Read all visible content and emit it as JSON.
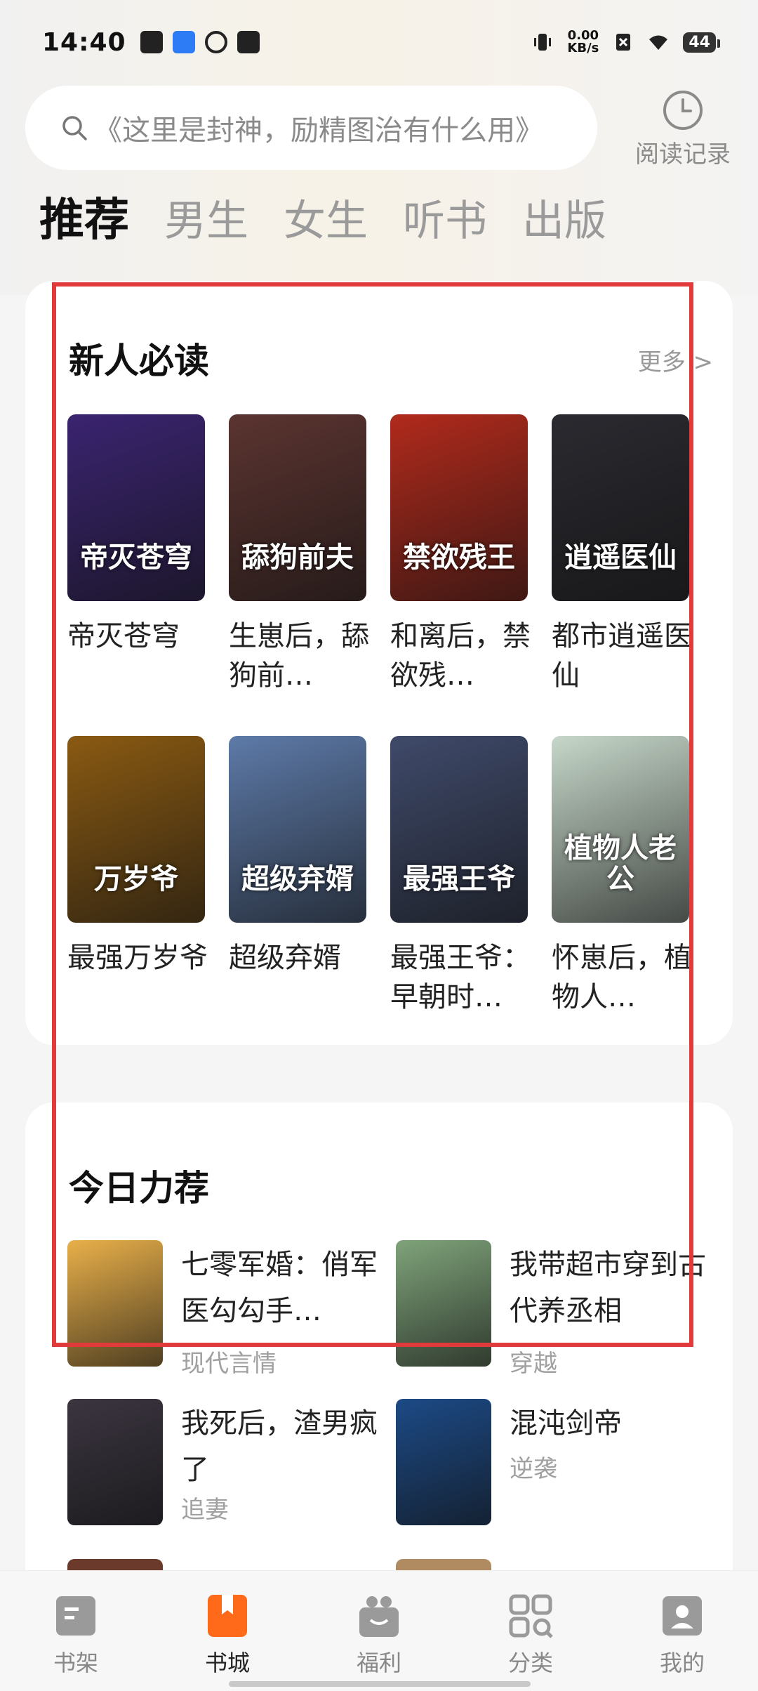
{
  "status_bar": {
    "time": "14:40",
    "net_speed_value": "0.00",
    "net_speed_unit": "KB/s",
    "battery": "44"
  },
  "search": {
    "placeholder": "《这里是封神，励精图治有什么用》"
  },
  "history": {
    "label": "阅读记录"
  },
  "tabs": [
    {
      "label": "推荐",
      "active": true
    },
    {
      "label": "男生"
    },
    {
      "label": "女生"
    },
    {
      "label": "听书"
    },
    {
      "label": "出版"
    }
  ],
  "newcomer": {
    "title": "新人必读",
    "more": "更多 >",
    "books": [
      {
        "title": "帝灭苍穹",
        "cover_text": "帝灭苍穹",
        "color": "#3a2470"
      },
      {
        "title": "生崽后，舔狗前…",
        "cover_text": "舔狗前夫",
        "color": "#5b3430"
      },
      {
        "title": "和离后，禁欲残…",
        "cover_text": "禁欲残王",
        "color": "#b12a1c"
      },
      {
        "title": "都市逍遥医仙",
        "cover_text": "逍遥医仙",
        "color": "#2a2a30"
      },
      {
        "title": "最强万岁爷",
        "cover_text": "万岁爷",
        "color": "#8a5a12"
      },
      {
        "title": "超级弃婿",
        "cover_text": "超级弃婿",
        "color": "#5d7aa8"
      },
      {
        "title": "最强王爷：早朝时…",
        "cover_text": "最强王爷",
        "color": "#3f4a6a"
      },
      {
        "title": "怀崽后，植物人…",
        "cover_text": "植物人老公",
        "color": "#c6d7c9"
      }
    ]
  },
  "today": {
    "title": "今日力荐",
    "items": [
      {
        "title": "七零军婚：俏军医勾勾手…",
        "tag": "现代言情",
        "color": "#e9b04a"
      },
      {
        "title": "我带超市穿到古代养丞相",
        "tag": "穿越",
        "color": "#7fa37a"
      },
      {
        "title": "我死后，渣男疯了",
        "tag": "追妻",
        "color": "#3b3540"
      },
      {
        "title": "混沌剑帝",
        "tag": "逆袭",
        "color": "#1c4a86"
      }
    ]
  },
  "bottom_nav": [
    {
      "label": "书架"
    },
    {
      "label": "书城",
      "active": true
    },
    {
      "label": "福利"
    },
    {
      "label": "分类"
    },
    {
      "label": "我的"
    }
  ],
  "accent_color": "#ff6a1a",
  "highlight_color": "#e03a3a"
}
